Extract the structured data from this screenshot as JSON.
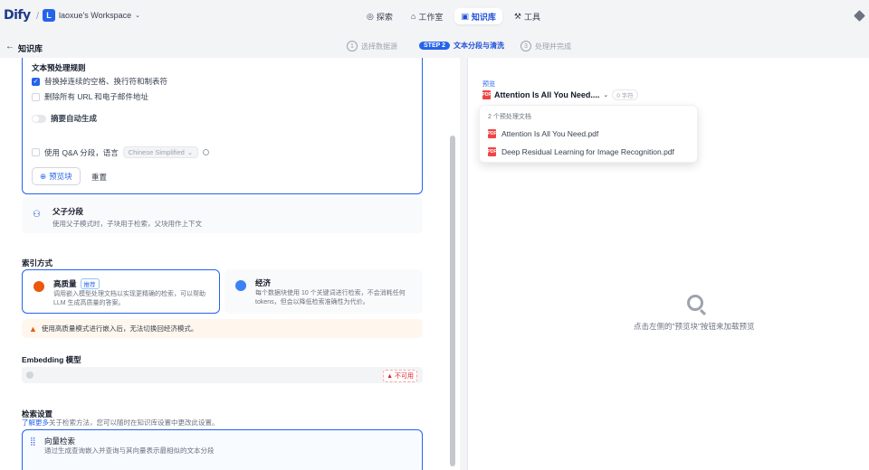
{
  "app": {
    "logo": "Dify",
    "workspace_initial": "L",
    "workspace_name": "laoxue's Workspace"
  },
  "nav": [
    {
      "label": "探索",
      "icon": "compass-icon"
    },
    {
      "label": "工作室",
      "icon": "studio-icon"
    },
    {
      "label": "知识库",
      "icon": "book-icon",
      "active": true
    },
    {
      "label": "工具",
      "icon": "hammer-icon"
    }
  ],
  "header": {
    "back": "←",
    "title": "知识库"
  },
  "steps": [
    {
      "num": "1",
      "label": "选择数据源"
    },
    {
      "num": "STEP 2",
      "label": "文本分段与清洗",
      "active": true
    },
    {
      "num": "3",
      "label": "处理并完成"
    }
  ],
  "rules": {
    "title": "文本预处理规则",
    "opt1": "替换掉连续的空格、换行符和制表符",
    "opt1_checked": true,
    "opt2": "删除所有 URL 和电子邮件地址",
    "opt2_checked": false,
    "auto_summary": "摘要自动生成",
    "qa_label": "使用 Q&A 分段，语言",
    "qa_lang": "Chinese Simplified",
    "preview_btn": "预览块",
    "reset_btn": "重置"
  },
  "parent_child": {
    "title": "父子分段",
    "desc": "使用父子模式时，子块用于检索，父块用作上下文"
  },
  "index": {
    "label": "索引方式",
    "hq_title": "高质量",
    "hq_badge": "推荐",
    "hq_desc": "调用嵌入模型处理文档以实现更精确的检索，可以帮助 LLM 生成高质量的答案。",
    "eco_title": "经济",
    "eco_desc": "每个数据块使用 10 个关键词进行检索，不会消耗任何 tokens，但会以降低检索准确性为代价。",
    "warning": "使用高质量模式进行嵌入后，无法切换回经济模式。"
  },
  "embedding": {
    "label": "Embedding 模型",
    "status": "不可用"
  },
  "retrieval": {
    "label": "检索设置",
    "hint_link": "了解更多",
    "hint_text": "关于检索方法，您可以随时在知识库设置中更改此设置。",
    "vec_title": "向量检索",
    "vec_desc": "通过生成查询嵌入并查询与其向量表示最相似的文本分段"
  },
  "preview": {
    "label": "预览",
    "selected_doc": "Attention Is All You Need....",
    "chars": "0 字符",
    "dropdown_head": "2 个预处理文档",
    "docs": [
      "Attention Is All You Need.pdf",
      "Deep Residual Learning for Image Recognition.pdf"
    ],
    "empty": "点击左侧的\"预览块\"按钮来加载预览"
  }
}
